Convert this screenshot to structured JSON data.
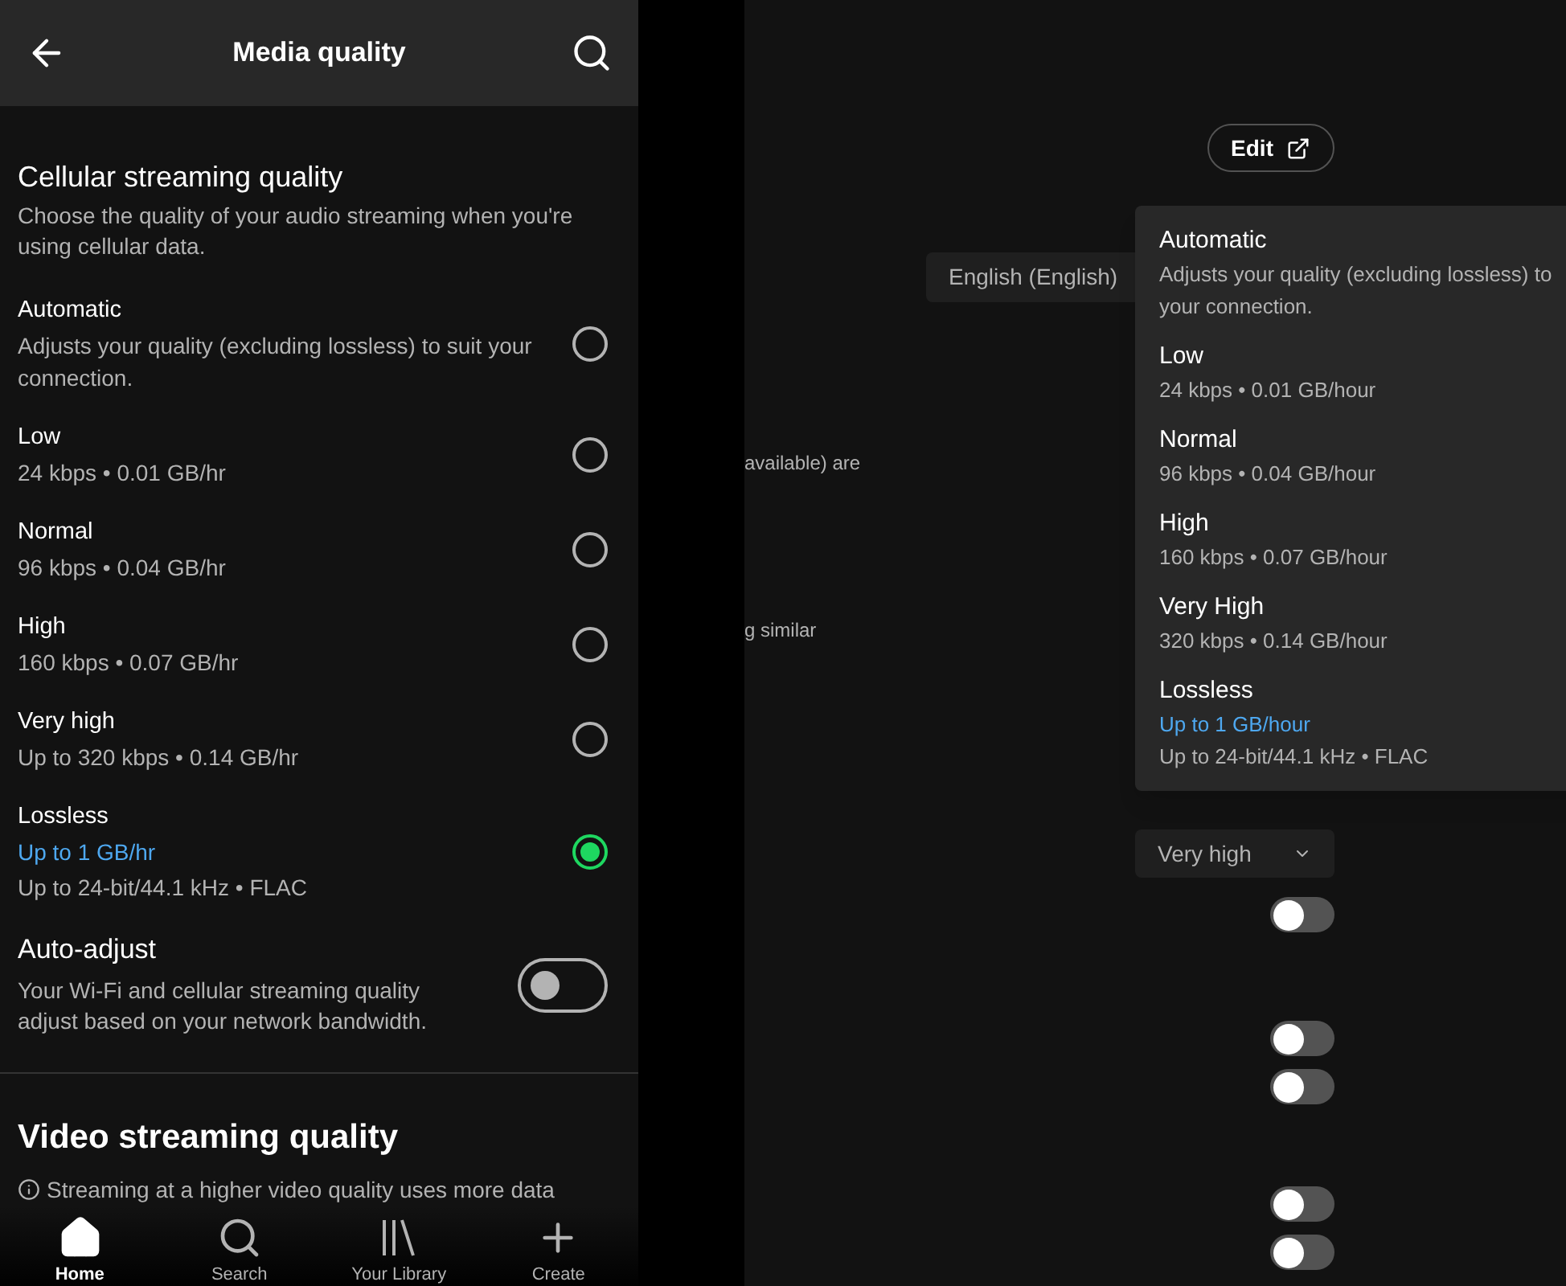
{
  "phone": {
    "header": {
      "title": "Media quality"
    },
    "cellular": {
      "title": "Cellular streaming quality",
      "description": "Choose the quality of your audio streaming when you're using cellular data.",
      "options": [
        {
          "label": "Automatic",
          "details": [
            {
              "text": "Adjusts your quality (excluding lossless) to suit your connection.",
              "kind": "plain"
            }
          ],
          "selected": false
        },
        {
          "label": "Low",
          "details": [
            {
              "text": "24 kbps • 0.01 GB/hr",
              "kind": "plain"
            }
          ],
          "selected": false
        },
        {
          "label": "Normal",
          "details": [
            {
              "text": "96 kbps • 0.04 GB/hr",
              "kind": "plain"
            }
          ],
          "selected": false
        },
        {
          "label": "High",
          "details": [
            {
              "text": "160 kbps • 0.07 GB/hr",
              "kind": "plain"
            }
          ],
          "selected": false
        },
        {
          "label": "Very high",
          "details": [
            {
              "text": "Up to 320 kbps • 0.14 GB/hr",
              "kind": "plain"
            }
          ],
          "selected": false
        },
        {
          "label": "Lossless",
          "details": [
            {
              "text": "Up to 1 GB/hr",
              "kind": "highlight"
            },
            {
              "text": "Up to 24-bit/44.1 kHz • FLAC",
              "kind": "plain"
            }
          ],
          "selected": true
        }
      ]
    },
    "auto_adjust": {
      "label": "Auto-adjust",
      "description": "Your Wi-Fi and cellular streaming quality adjust based on your network bandwidth.",
      "on": false
    },
    "video": {
      "title": "Video streaming quality",
      "notice": "Streaming at a higher video quality uses more data"
    },
    "nav": [
      {
        "label": "Home",
        "kind": "home",
        "selected": true
      },
      {
        "label": "Search",
        "kind": "search",
        "selected": false
      },
      {
        "label": "Your Library",
        "kind": "library",
        "selected": false
      },
      {
        "label": "Create",
        "kind": "create",
        "selected": false
      }
    ]
  },
  "desktop": {
    "edit_button": "Edit",
    "language_select": "English (English)",
    "text_fragments": [
      "available) are",
      "g similar"
    ],
    "quality_select": "Very high",
    "toggles": [
      {
        "on": false
      },
      {
        "on": false
      },
      {
        "on": false
      },
      {
        "on": false
      },
      {
        "on": false
      }
    ],
    "menu": {
      "options": [
        {
          "label": "Automatic",
          "lines": [
            {
              "text": "Adjusts your quality (excluding lossless) to",
              "kind": "plain"
            },
            {
              "text": "your connection.",
              "kind": "plain"
            }
          ]
        },
        {
          "label": "Low",
          "lines": [
            {
              "text": "24 kbps • 0.01 GB/hour",
              "kind": "plain"
            }
          ]
        },
        {
          "label": "Normal",
          "lines": [
            {
              "text": "96 kbps • 0.04 GB/hour",
              "kind": "plain"
            }
          ]
        },
        {
          "label": "High",
          "lines": [
            {
              "text": "160 kbps • 0.07 GB/hour",
              "kind": "plain"
            }
          ]
        },
        {
          "label": "Very High",
          "lines": [
            {
              "text": "320 kbps • 0.14 GB/hour",
              "kind": "plain"
            }
          ]
        },
        {
          "label": "Lossless",
          "lines": [
            {
              "text": "Up to 1 GB/hour",
              "kind": "highlight"
            },
            {
              "text": "Up to 24-bit/44.1 kHz • FLAC",
              "kind": "plain"
            }
          ]
        }
      ]
    }
  }
}
